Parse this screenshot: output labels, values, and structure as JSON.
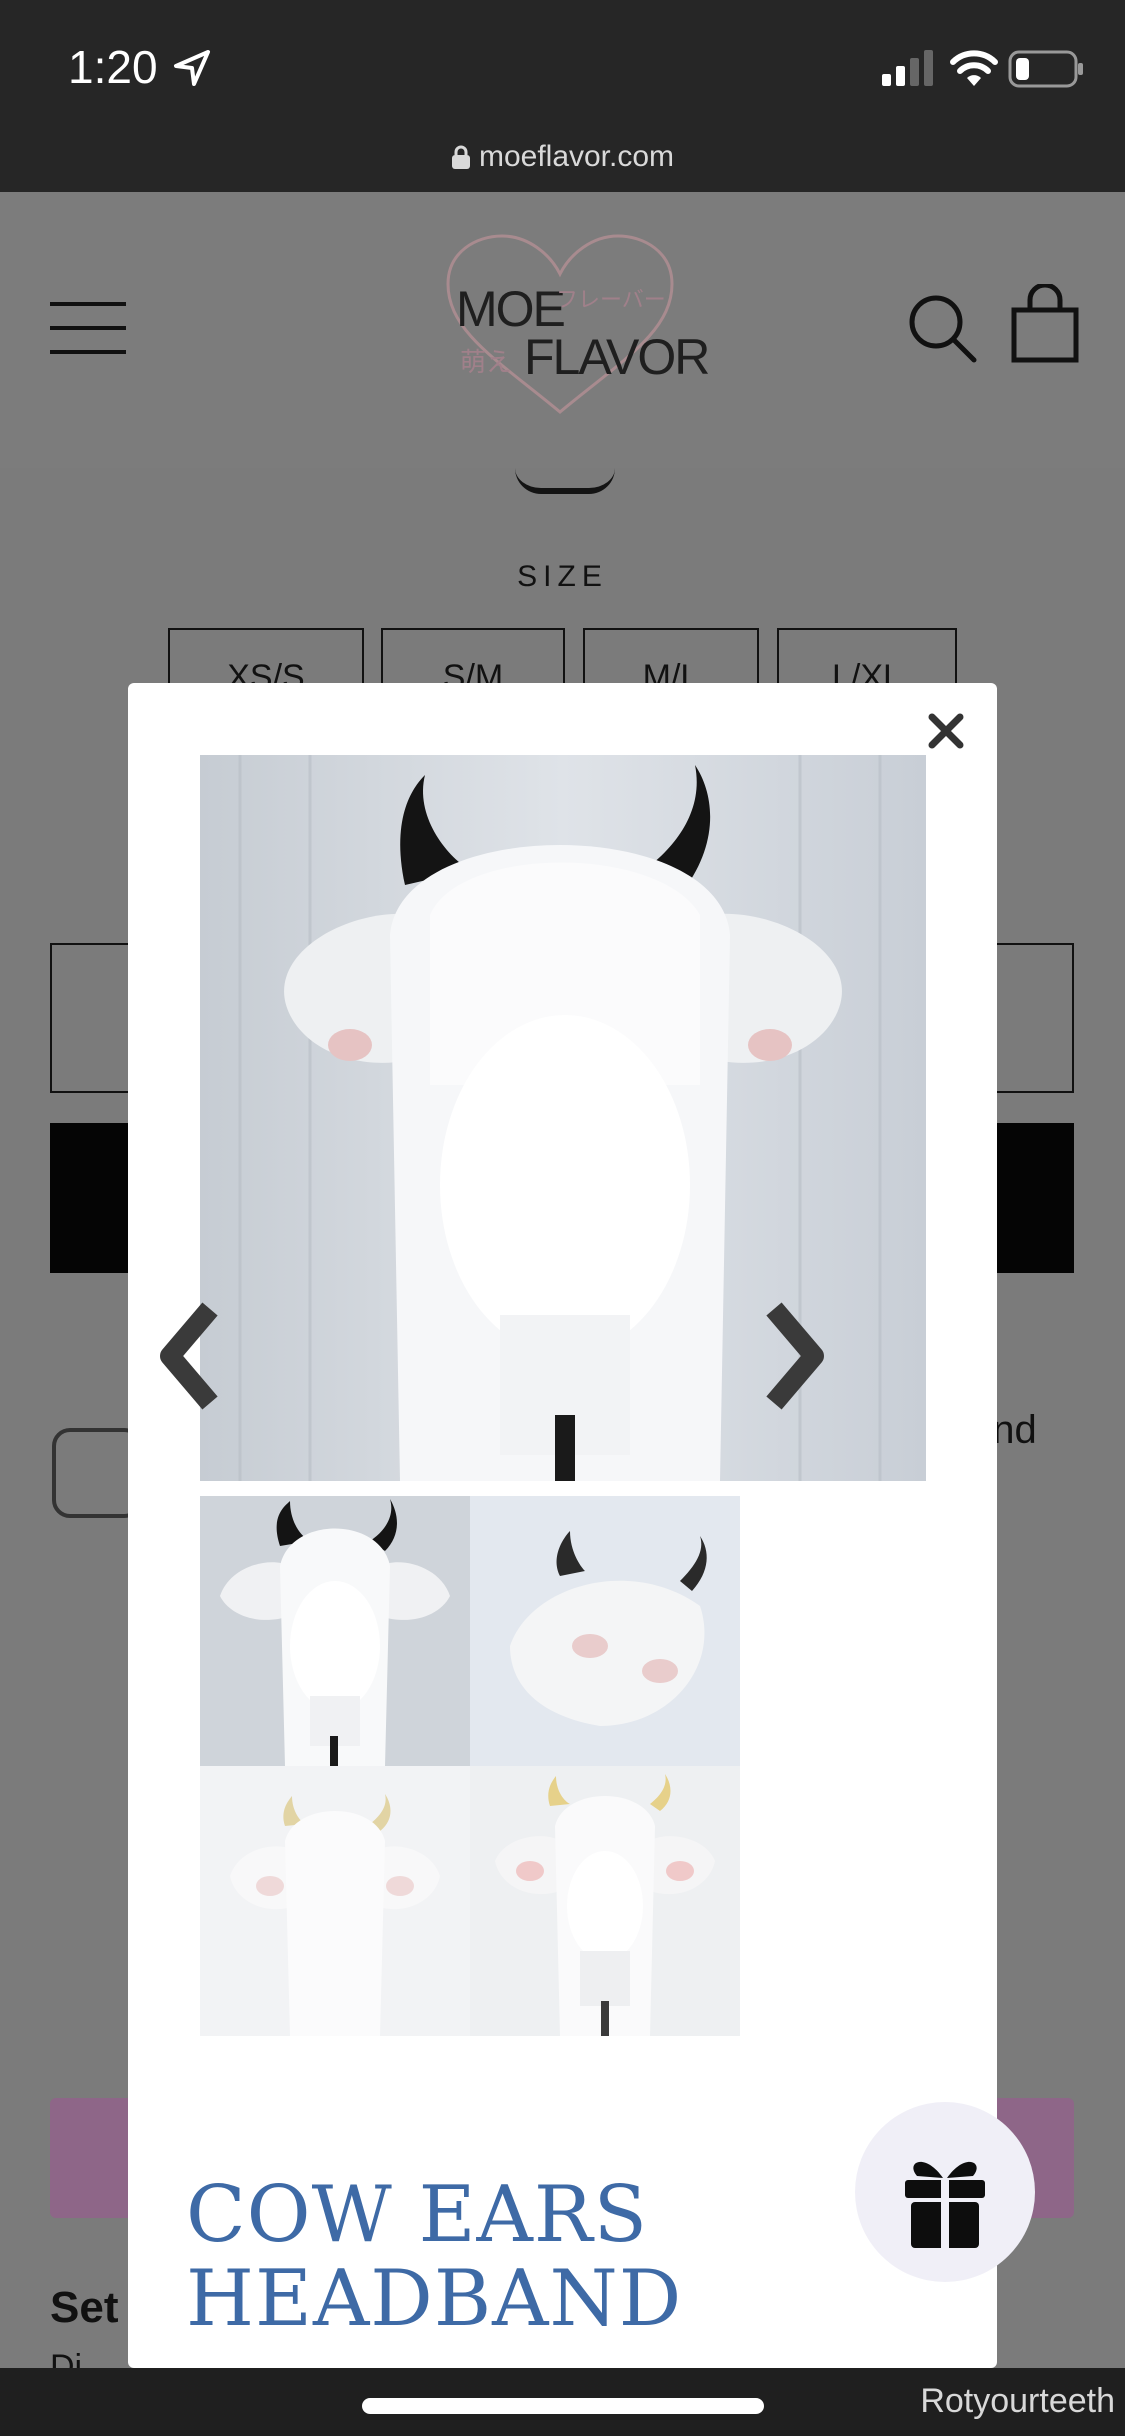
{
  "status_bar": {
    "time": "1:20",
    "url": "moeflavor.com"
  },
  "header": {
    "logo_text_top": "MOE",
    "logo_text_bottom": "FLAVOR",
    "logo_jp_katakana": "フレーバー",
    "logo_jp_kanji": "萌え",
    "logo_color": "#e3a3b0"
  },
  "background_page": {
    "size_label": "SIZE",
    "sizes": [
      "XS/S",
      "S/M",
      "M/L",
      "L/XL"
    ],
    "side_text": "and",
    "set_text": "Set",
    "small_text": "Di"
  },
  "modal": {
    "close_label": "×",
    "title_line1": "COW EARS",
    "title_line2": "HEADBAND",
    "title_color": "#3e6aa6"
  },
  "watermark": "Rotyourteeth"
}
